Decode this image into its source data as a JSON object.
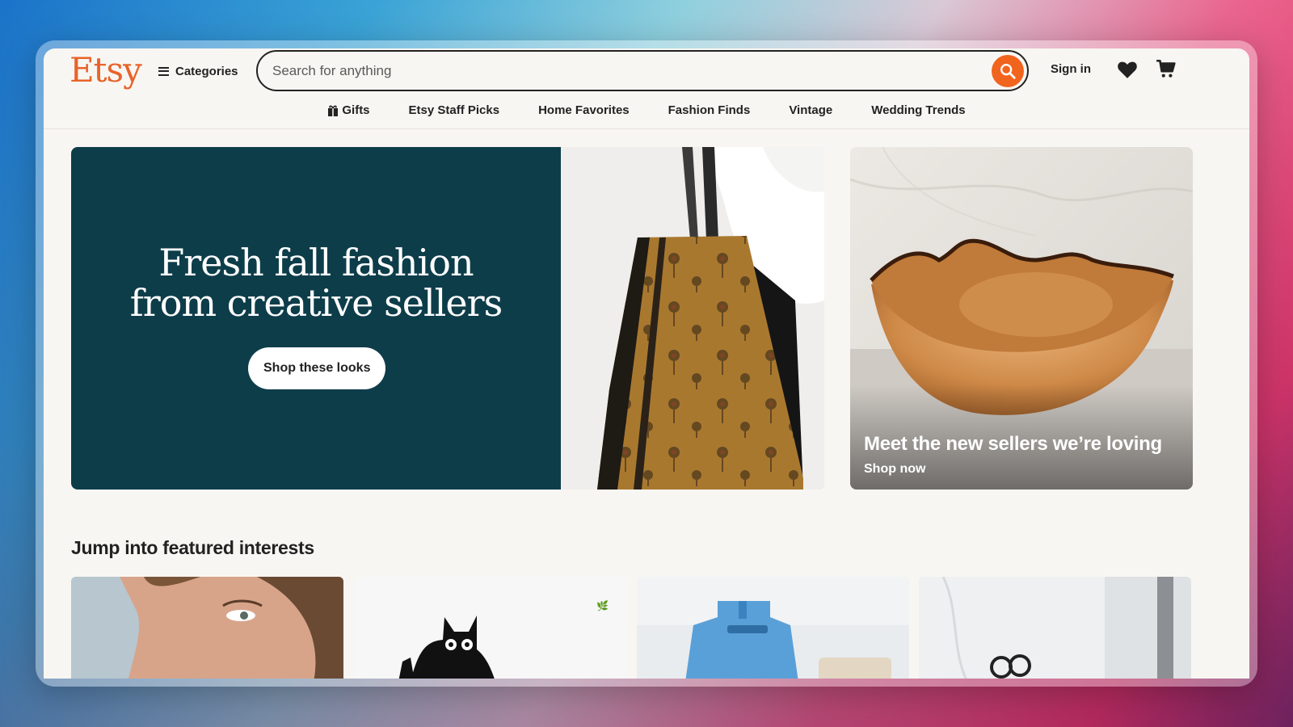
{
  "header": {
    "logo": "Etsy",
    "categories_label": "Categories",
    "search_placeholder": "Search for anything",
    "signin_label": "Sign in"
  },
  "subnav": [
    {
      "label": "Gifts",
      "icon": "gift-icon"
    },
    {
      "label": "Etsy Staff Picks"
    },
    {
      "label": "Home Favorites"
    },
    {
      "label": "Fashion Finds"
    },
    {
      "label": "Vintage"
    },
    {
      "label": "Wedding Trends"
    }
  ],
  "hero": {
    "headline_line1": "Fresh fall fashion",
    "headline_line2": "from creative sellers",
    "cta_label": "Shop these looks",
    "side_title": "Meet the new sellers we’re loving",
    "side_cta": "Shop now"
  },
  "featured": {
    "title": "Jump into featured interests"
  },
  "colors": {
    "brand": "#f1641e",
    "hero_bg": "#0e3d4a",
    "page_bg": "#f8f6f2"
  }
}
